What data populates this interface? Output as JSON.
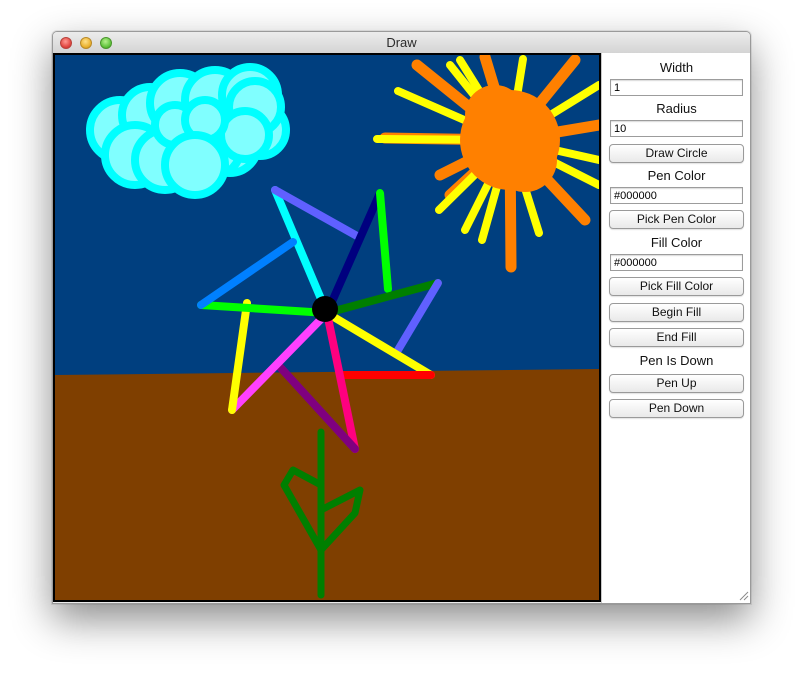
{
  "window": {
    "title": "Draw"
  },
  "panel": {
    "width_label": "Width",
    "width_value": "1",
    "radius_label": "Radius",
    "radius_value": "10",
    "draw_circle_label": "Draw Circle",
    "pen_color_label": "Pen Color",
    "pen_color_value": "#000000",
    "pick_pen_color_label": "Pick Pen Color",
    "fill_color_label": "Fill Color",
    "fill_color_value": "#000000",
    "pick_fill_color_label": "Pick Fill Color",
    "begin_fill_label": "Begin Fill",
    "end_fill_label": "End Fill",
    "pen_status": "Pen Is Down",
    "pen_up_label": "Pen Up",
    "pen_down_label": "Pen Down"
  },
  "colors": {
    "sky": "#003f7f",
    "ground": "#7f3f00",
    "sun": "#ff8000",
    "sun_rays_yellow": "#ffff00",
    "cloud": "#80ffff",
    "cloud_outline": "#00ffff",
    "stem": "#007f00",
    "flower_center": "#000000"
  }
}
